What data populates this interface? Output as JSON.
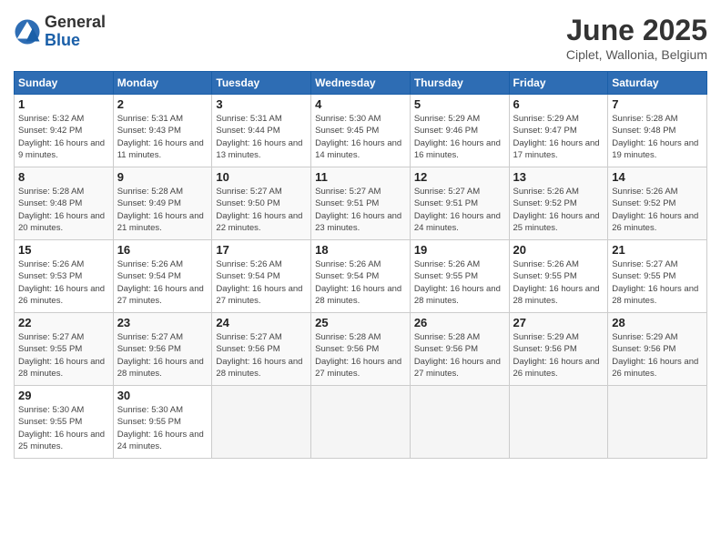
{
  "logo": {
    "general": "General",
    "blue": "Blue"
  },
  "title": "June 2025",
  "location": "Ciplet, Wallonia, Belgium",
  "days_header": [
    "Sunday",
    "Monday",
    "Tuesday",
    "Wednesday",
    "Thursday",
    "Friday",
    "Saturday"
  ],
  "weeks": [
    [
      {
        "day": "1",
        "sunrise": "5:32 AM",
        "sunset": "9:42 PM",
        "daylight": "16 hours and 9 minutes."
      },
      {
        "day": "2",
        "sunrise": "5:31 AM",
        "sunset": "9:43 PM",
        "daylight": "16 hours and 11 minutes."
      },
      {
        "day": "3",
        "sunrise": "5:31 AM",
        "sunset": "9:44 PM",
        "daylight": "16 hours and 13 minutes."
      },
      {
        "day": "4",
        "sunrise": "5:30 AM",
        "sunset": "9:45 PM",
        "daylight": "16 hours and 14 minutes."
      },
      {
        "day": "5",
        "sunrise": "5:29 AM",
        "sunset": "9:46 PM",
        "daylight": "16 hours and 16 minutes."
      },
      {
        "day": "6",
        "sunrise": "5:29 AM",
        "sunset": "9:47 PM",
        "daylight": "16 hours and 17 minutes."
      },
      {
        "day": "7",
        "sunrise": "5:28 AM",
        "sunset": "9:48 PM",
        "daylight": "16 hours and 19 minutes."
      }
    ],
    [
      {
        "day": "8",
        "sunrise": "5:28 AM",
        "sunset": "9:48 PM",
        "daylight": "16 hours and 20 minutes."
      },
      {
        "day": "9",
        "sunrise": "5:28 AM",
        "sunset": "9:49 PM",
        "daylight": "16 hours and 21 minutes."
      },
      {
        "day": "10",
        "sunrise": "5:27 AM",
        "sunset": "9:50 PM",
        "daylight": "16 hours and 22 minutes."
      },
      {
        "day": "11",
        "sunrise": "5:27 AM",
        "sunset": "9:51 PM",
        "daylight": "16 hours and 23 minutes."
      },
      {
        "day": "12",
        "sunrise": "5:27 AM",
        "sunset": "9:51 PM",
        "daylight": "16 hours and 24 minutes."
      },
      {
        "day": "13",
        "sunrise": "5:26 AM",
        "sunset": "9:52 PM",
        "daylight": "16 hours and 25 minutes."
      },
      {
        "day": "14",
        "sunrise": "5:26 AM",
        "sunset": "9:52 PM",
        "daylight": "16 hours and 26 minutes."
      }
    ],
    [
      {
        "day": "15",
        "sunrise": "5:26 AM",
        "sunset": "9:53 PM",
        "daylight": "16 hours and 26 minutes."
      },
      {
        "day": "16",
        "sunrise": "5:26 AM",
        "sunset": "9:54 PM",
        "daylight": "16 hours and 27 minutes."
      },
      {
        "day": "17",
        "sunrise": "5:26 AM",
        "sunset": "9:54 PM",
        "daylight": "16 hours and 27 minutes."
      },
      {
        "day": "18",
        "sunrise": "5:26 AM",
        "sunset": "9:54 PM",
        "daylight": "16 hours and 28 minutes."
      },
      {
        "day": "19",
        "sunrise": "5:26 AM",
        "sunset": "9:55 PM",
        "daylight": "16 hours and 28 minutes."
      },
      {
        "day": "20",
        "sunrise": "5:26 AM",
        "sunset": "9:55 PM",
        "daylight": "16 hours and 28 minutes."
      },
      {
        "day": "21",
        "sunrise": "5:27 AM",
        "sunset": "9:55 PM",
        "daylight": "16 hours and 28 minutes."
      }
    ],
    [
      {
        "day": "22",
        "sunrise": "5:27 AM",
        "sunset": "9:55 PM",
        "daylight": "16 hours and 28 minutes."
      },
      {
        "day": "23",
        "sunrise": "5:27 AM",
        "sunset": "9:56 PM",
        "daylight": "16 hours and 28 minutes."
      },
      {
        "day": "24",
        "sunrise": "5:27 AM",
        "sunset": "9:56 PM",
        "daylight": "16 hours and 28 minutes."
      },
      {
        "day": "25",
        "sunrise": "5:28 AM",
        "sunset": "9:56 PM",
        "daylight": "16 hours and 27 minutes."
      },
      {
        "day": "26",
        "sunrise": "5:28 AM",
        "sunset": "9:56 PM",
        "daylight": "16 hours and 27 minutes."
      },
      {
        "day": "27",
        "sunrise": "5:29 AM",
        "sunset": "9:56 PM",
        "daylight": "16 hours and 26 minutes."
      },
      {
        "day": "28",
        "sunrise": "5:29 AM",
        "sunset": "9:56 PM",
        "daylight": "16 hours and 26 minutes."
      }
    ],
    [
      {
        "day": "29",
        "sunrise": "5:30 AM",
        "sunset": "9:55 PM",
        "daylight": "16 hours and 25 minutes."
      },
      {
        "day": "30",
        "sunrise": "5:30 AM",
        "sunset": "9:55 PM",
        "daylight": "16 hours and 24 minutes."
      },
      null,
      null,
      null,
      null,
      null
    ]
  ]
}
